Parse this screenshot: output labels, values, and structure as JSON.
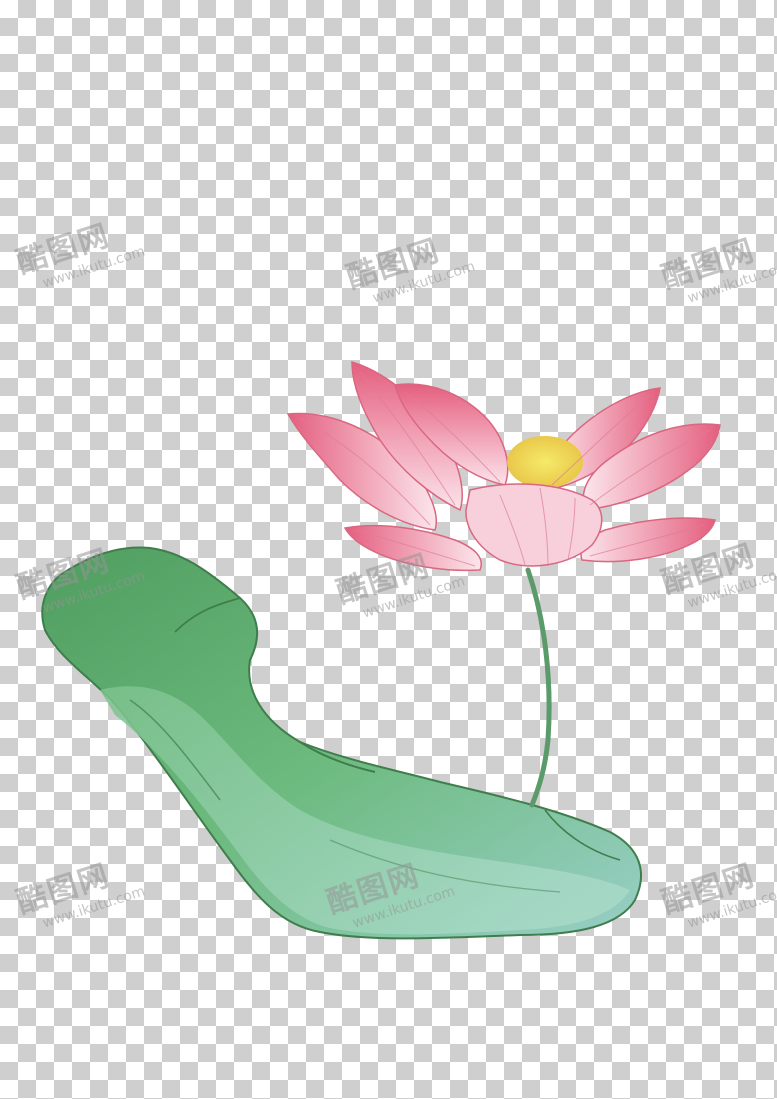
{
  "image": {
    "subject": "lotus-flower-and-leaf",
    "background": "transparency-checkerboard",
    "colors": {
      "checker_light": "#ffffff",
      "checker_dark": "#cfcfcf",
      "petal_pink": "#e9809a",
      "petal_light": "#f9dbe4",
      "center_yellow": "#efe05a",
      "leaf_green": "#5fae73",
      "leaf_light": "#a8d7bd",
      "leaf_teal": "#8fcac8",
      "stem_green": "#5b9a6a"
    }
  },
  "watermark": {
    "brand": "酷图网",
    "url": "www.ikutu.com"
  }
}
